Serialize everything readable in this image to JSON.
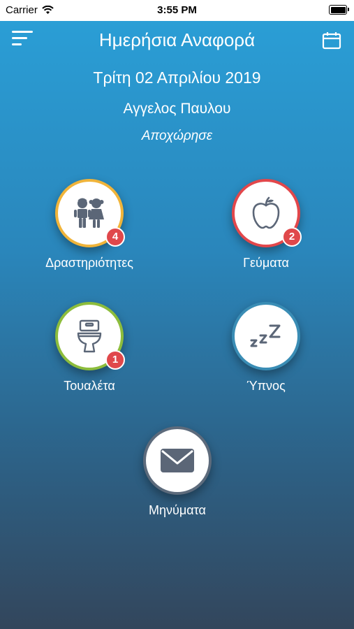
{
  "status_bar": {
    "carrier": "Carrier",
    "time": "3:55 PM"
  },
  "header": {
    "title": "Ημερήσια Αναφορά"
  },
  "report": {
    "date": "Τρίτη 02 Απριλίου 2019",
    "child_name": "Αγγελος Παυλου",
    "status": "Αποχώρησε"
  },
  "tiles": {
    "activities": {
      "label": "Δραστηριότητες",
      "badge": "4",
      "ring_color": "#f0b43a",
      "icon": "children-icon"
    },
    "meals": {
      "label": "Γεύματα",
      "badge": "2",
      "ring_color": "#e2474b",
      "icon": "apple-icon"
    },
    "toilet": {
      "label": "Τουαλέτα",
      "badge": "1",
      "ring_color": "#8dbd3c",
      "icon": "toilet-icon"
    },
    "sleep": {
      "label": "Ύπνος",
      "ring_color": "#3a8db5",
      "icon": "sleep-icon"
    },
    "messages": {
      "label": "Μηνύματα",
      "ring_color": "#5d6b7c",
      "icon": "envelope-icon"
    }
  }
}
